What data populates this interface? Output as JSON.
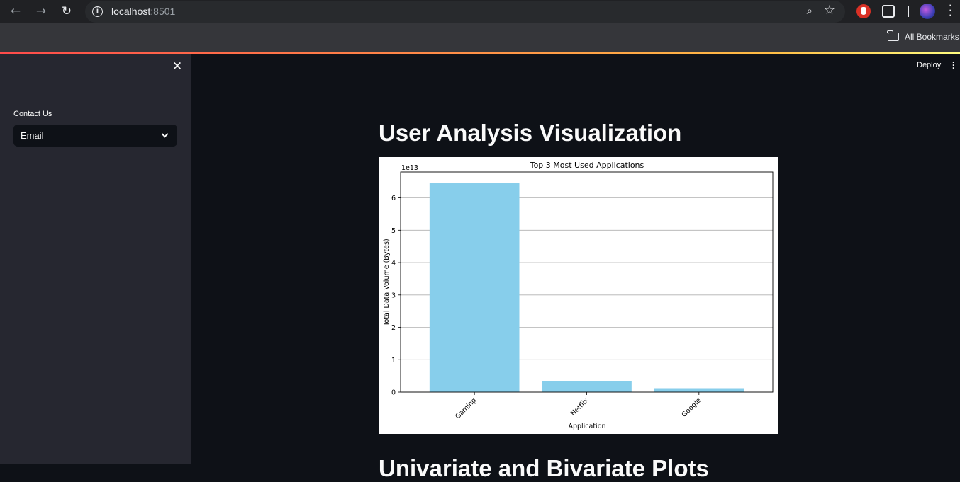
{
  "browser": {
    "url_host": "localhost",
    "url_port": ":8501",
    "bookmarks_label": "All Bookmarks",
    "icons": [
      "back-icon",
      "forward-icon",
      "reload-icon",
      "site-info-icon",
      "zoom-icon",
      "star-icon",
      "extension-icon",
      "puzzle-icon",
      "profile-avatar",
      "menu-icon",
      "folder-icon"
    ]
  },
  "sidebar": {
    "contact_label": "Contact Us",
    "contact_value": "Email"
  },
  "header": {
    "deploy_label": "Deploy"
  },
  "main": {
    "title": "User Analysis Visualization",
    "next_heading": "Univariate and Bivariate Plots"
  },
  "chart_data": {
    "type": "bar",
    "title": "Top 3 Most Used Applications",
    "xlabel": "Application",
    "ylabel": "Total Data Volume (Bytes)",
    "offset_label": "1e13",
    "categories": [
      "Gaming",
      "Netflix",
      "Google"
    ],
    "values": [
      64500000000000.0,
      3500000000000.0,
      1200000000000.0
    ],
    "ylim": [
      0,
      68000000000000.0
    ],
    "yticks": [
      "0",
      "1",
      "2",
      "3",
      "4",
      "5",
      "6"
    ],
    "grid": "y",
    "color": "#87ceeb"
  }
}
